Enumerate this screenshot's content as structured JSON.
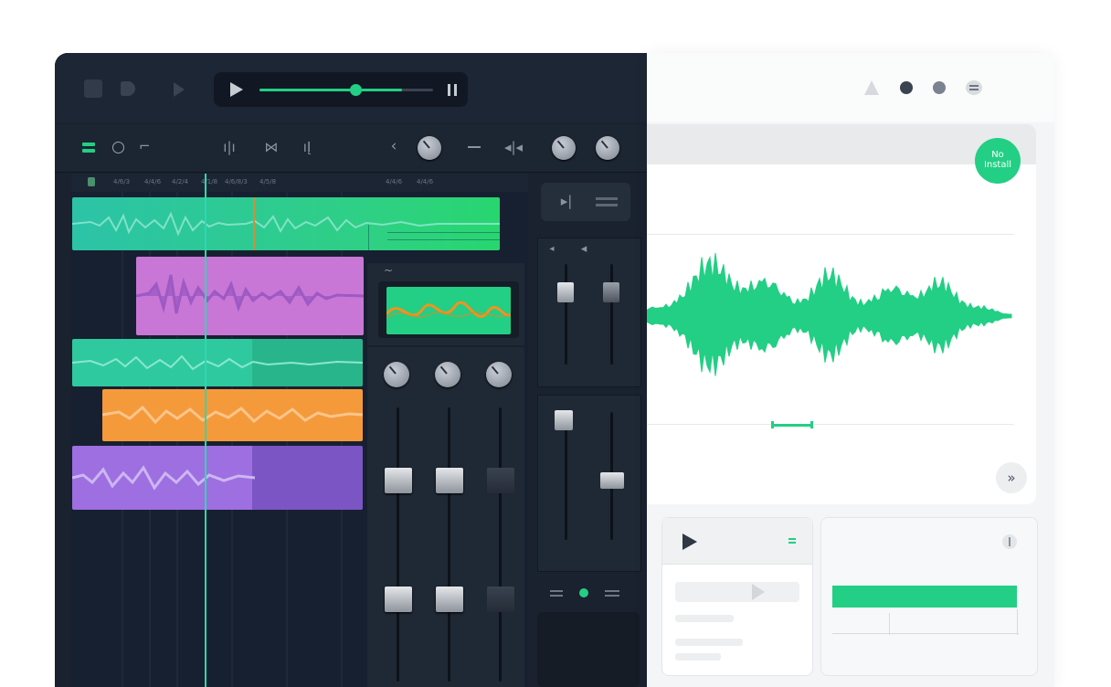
{
  "colors": {
    "accent": "#22cf84",
    "teal_clip": "#2fc9a0",
    "purple_clip": "#c877d6",
    "orange_clip": "#f59a3a",
    "violet_clip": "#9d6fe0",
    "dark_bg": "#1a2230"
  },
  "transport": {
    "progress": 0.55,
    "stop_icon": "stop-icon",
    "play_icon": "play-icon",
    "pause_icon": "pause-icon"
  },
  "ruler": {
    "labels": [
      "4/6/3",
      "4/4/6",
      "4/2/4",
      "4/1/8",
      "4/6/8/3",
      "4/5/8",
      "4/4/6",
      "4/4/6"
    ]
  },
  "badge": {
    "line1": "No",
    "line2": "Install"
  },
  "light_panel": {
    "progress": 0.7
  }
}
